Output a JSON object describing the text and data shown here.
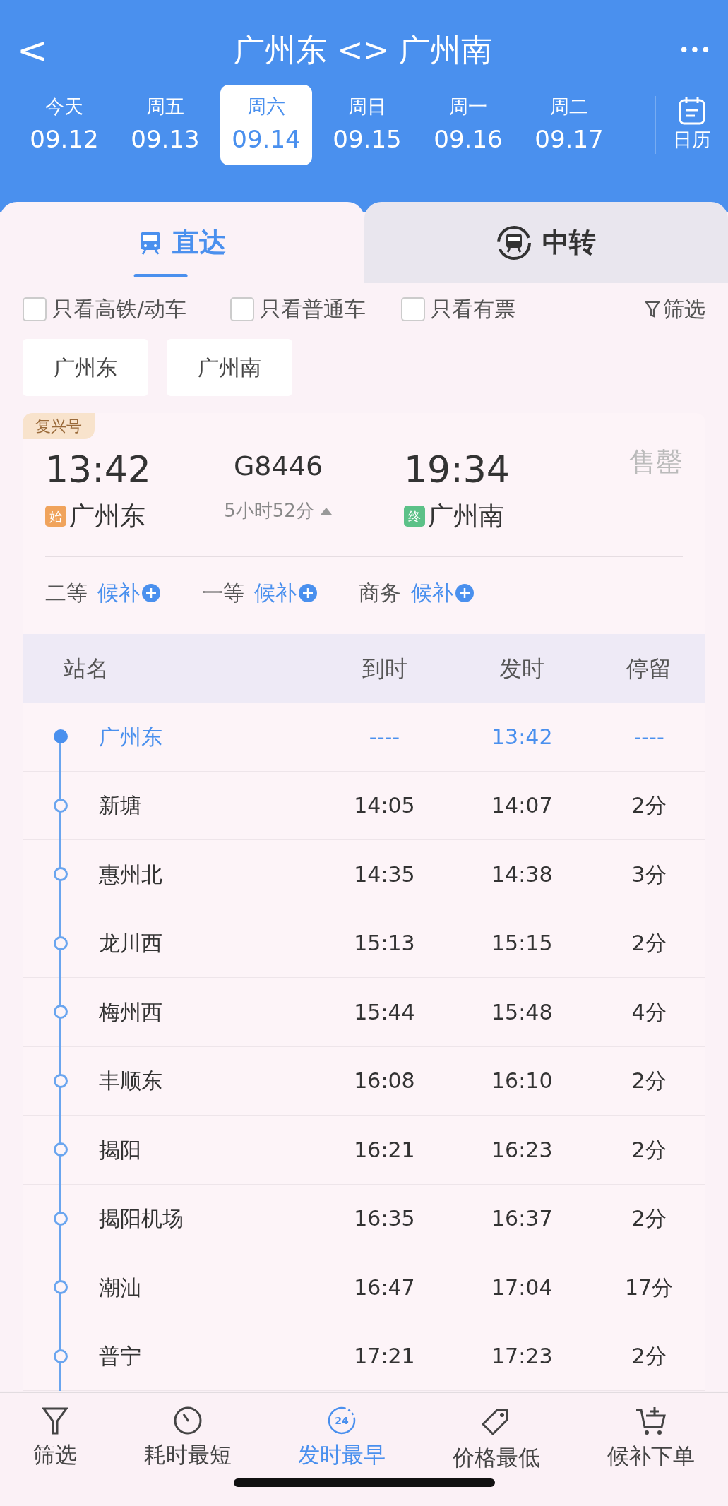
{
  "header": {
    "back": "<",
    "title": "广州东 <> 广州南",
    "more": "•••"
  },
  "dates": [
    {
      "weekday": "今天",
      "date": "09.12",
      "selected": false
    },
    {
      "weekday": "周五",
      "date": "09.13",
      "selected": false
    },
    {
      "weekday": "周六",
      "date": "09.14",
      "selected": true
    },
    {
      "weekday": "周日",
      "date": "09.15",
      "selected": false
    },
    {
      "weekday": "周一",
      "date": "09.16",
      "selected": false
    },
    {
      "weekday": "周二",
      "date": "09.17",
      "selected": false
    }
  ],
  "calendar": {
    "label": "日历"
  },
  "tabs": [
    {
      "label": "直达",
      "kind": "direct",
      "selected": true
    },
    {
      "label": "中转",
      "kind": "transfer",
      "selected": false
    }
  ],
  "filters": [
    {
      "label": "只看高铁/动车",
      "checked": false
    },
    {
      "label": "只看普通车",
      "checked": false
    },
    {
      "label": "只看有票",
      "checked": false
    }
  ],
  "filter_button": "筛选",
  "stations": [
    "广州东",
    "广州南"
  ],
  "train": {
    "badge": "复兴号",
    "depart_time": "13:42",
    "number": "G8446",
    "arrive_time": "19:34",
    "status": "售罄",
    "from_tag": "始",
    "from": "广州东",
    "duration": "5小时52分",
    "expanded": true,
    "to_tag": "终",
    "to": "广州南",
    "seats": [
      {
        "class": "二等",
        "action": "候补"
      },
      {
        "class": "一等",
        "action": "候补"
      },
      {
        "class": "商务",
        "action": "候补"
      }
    ]
  },
  "stops_table": {
    "columns": [
      "站名",
      "到时",
      "发时",
      "停留"
    ],
    "rows": [
      {
        "station": "广州东",
        "arrive": "----",
        "depart": "13:42",
        "stay": "----",
        "selected": true
      },
      {
        "station": "新塘",
        "arrive": "14:05",
        "depart": "14:07",
        "stay": "2分",
        "selected": false
      },
      {
        "station": "惠州北",
        "arrive": "14:35",
        "depart": "14:38",
        "stay": "3分",
        "selected": false
      },
      {
        "station": "龙川西",
        "arrive": "15:13",
        "depart": "15:15",
        "stay": "2分",
        "selected": false
      },
      {
        "station": "梅州西",
        "arrive": "15:44",
        "depart": "15:48",
        "stay": "4分",
        "selected": false
      },
      {
        "station": "丰顺东",
        "arrive": "16:08",
        "depart": "16:10",
        "stay": "2分",
        "selected": false
      },
      {
        "station": "揭阳",
        "arrive": "16:21",
        "depart": "16:23",
        "stay": "2分",
        "selected": false
      },
      {
        "station": "揭阳机场",
        "arrive": "16:35",
        "depart": "16:37",
        "stay": "2分",
        "selected": false
      },
      {
        "station": "潮汕",
        "arrive": "16:47",
        "depart": "17:04",
        "stay": "17分",
        "selected": false
      },
      {
        "station": "普宁",
        "arrive": "17:21",
        "depart": "17:23",
        "stay": "2分",
        "selected": false
      }
    ]
  },
  "bottom_bar": [
    {
      "label": "筛选",
      "kind": "filter",
      "selected": false
    },
    {
      "label": "耗时最短",
      "kind": "timer",
      "selected": false
    },
    {
      "label": "发时最早",
      "kind": "clock24",
      "icon_text": "24",
      "selected": true
    },
    {
      "label": "价格最低",
      "kind": "tag",
      "selected": false
    },
    {
      "label": "候补下单",
      "kind": "cart",
      "selected": false
    }
  ]
}
